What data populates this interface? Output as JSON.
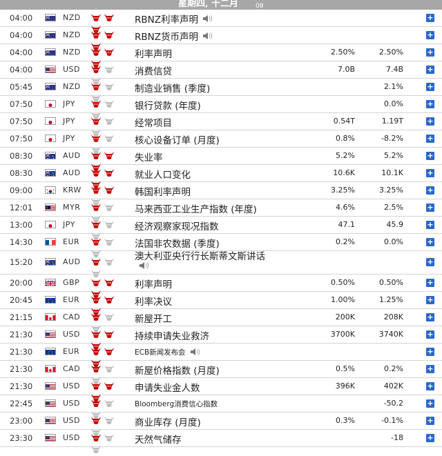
{
  "header": {
    "day": "星期四, 十二月",
    "date": "08"
  },
  "colors": {
    "bull_active": "#c40000",
    "bull_inactive": "#bdbdbd",
    "plus": "#2b67c6"
  },
  "rows": [
    {
      "time": "04:00",
      "flag": "nz",
      "currency": "NZD",
      "importance": 3,
      "event": "RBNZ利率声明",
      "speaker": true,
      "actual": "",
      "previous": ""
    },
    {
      "time": "04:00",
      "flag": "nz",
      "currency": "NZD",
      "importance": 3,
      "event": "RBNZ货币声明",
      "speaker": true,
      "actual": "",
      "previous": ""
    },
    {
      "time": "04:00",
      "flag": "nz",
      "currency": "NZD",
      "importance": 3,
      "event": "利率声明",
      "speaker": false,
      "actual": "2.50%",
      "previous": "2.50%"
    },
    {
      "time": "04:00",
      "flag": "us",
      "currency": "USD",
      "importance": 1,
      "event": "消费信贷",
      "speaker": false,
      "actual": "7.0B",
      "previous": "7.4B"
    },
    {
      "time": "05:45",
      "flag": "nz",
      "currency": "NZD",
      "importance": 1,
      "event": "制造业销售 (季度)",
      "speaker": false,
      "actual": "",
      "previous": "2.1%"
    },
    {
      "time": "07:50",
      "flag": "jp",
      "currency": "JPY",
      "importance": 1,
      "event": "银行贷款 (年度)",
      "speaker": false,
      "actual": "",
      "previous": "0.0%"
    },
    {
      "time": "07:50",
      "flag": "jp",
      "currency": "JPY",
      "importance": 1,
      "event": "经常项目",
      "speaker": false,
      "actual": "0.54T",
      "previous": "1.19T"
    },
    {
      "time": "07:50",
      "flag": "jp",
      "currency": "JPY",
      "importance": 1,
      "event": "核心设备订单 (月度)",
      "speaker": false,
      "actual": "0.8%",
      "previous": "-8.2%"
    },
    {
      "time": "08:30",
      "flag": "au",
      "currency": "AUD",
      "importance": 3,
      "event": "失业率",
      "speaker": false,
      "actual": "5.2%",
      "previous": "5.2%"
    },
    {
      "time": "08:30",
      "flag": "au",
      "currency": "AUD",
      "importance": 3,
      "event": "就业人口变化",
      "speaker": false,
      "actual": "10.6K",
      "previous": "10.1K"
    },
    {
      "time": "09:00",
      "flag": "kr",
      "currency": "KRW",
      "importance": 2,
      "event": "韩国利率声明",
      "speaker": false,
      "actual": "3.25%",
      "previous": "3.25%"
    },
    {
      "time": "12:01",
      "flag": "my",
      "currency": "MYR",
      "importance": 1,
      "event": "马来西亚工业生产指数 (年度)",
      "speaker": false,
      "actual": "4.6%",
      "previous": "2.5%"
    },
    {
      "time": "13:00",
      "flag": "jp",
      "currency": "JPY",
      "importance": 1,
      "event": "经济观察家现况指数",
      "speaker": false,
      "actual": "47.1",
      "previous": "45.9"
    },
    {
      "time": "14:30",
      "flag": "fr",
      "currency": "EUR",
      "importance": 1,
      "event": "法国非农数据 (季度)",
      "speaker": false,
      "actual": "0.2%",
      "previous": "0.0%"
    },
    {
      "time": "15:20",
      "flag": "au",
      "currency": "AUD",
      "importance": 1,
      "event": "澳大利亚央行行长斯蒂文斯讲话",
      "speaker": true,
      "actual": "",
      "previous": "",
      "tall": true
    },
    {
      "time": "20:00",
      "flag": "gb",
      "currency": "GBP",
      "importance": 3,
      "event": "利率声明",
      "speaker": false,
      "actual": "0.50%",
      "previous": "0.50%"
    },
    {
      "time": "20:45",
      "flag": "eu",
      "currency": "EUR",
      "importance": 3,
      "event": "利率决议",
      "speaker": false,
      "actual": "1.00%",
      "previous": "1.25%"
    },
    {
      "time": "21:15",
      "flag": "ca",
      "currency": "CAD",
      "importance": 1,
      "event": "新屋开工",
      "speaker": false,
      "actual": "200K",
      "previous": "208K"
    },
    {
      "time": "21:30",
      "flag": "us",
      "currency": "USD",
      "importance": 3,
      "event": "持续申请失业救济",
      "speaker": false,
      "actual": "3700K",
      "previous": "3740K"
    },
    {
      "time": "21:30",
      "flag": "eu",
      "currency": "EUR",
      "importance": 3,
      "event": "ECB新闻发布会",
      "speaker": true,
      "actual": "",
      "previous": "",
      "small": true
    },
    {
      "time": "21:30",
      "flag": "ca",
      "currency": "CAD",
      "importance": 1,
      "event": "新屋价格指数 (月度)",
      "speaker": false,
      "actual": "0.5%",
      "previous": "0.2%"
    },
    {
      "time": "21:30",
      "flag": "us",
      "currency": "USD",
      "importance": 3,
      "event": "申请失业金人数",
      "speaker": false,
      "actual": "396K",
      "previous": "402K"
    },
    {
      "time": "22:45",
      "flag": "us",
      "currency": "USD",
      "importance": 1,
      "event": "Bloomberg消费信心指数",
      "speaker": false,
      "actual": "",
      "previous": "-50.2",
      "small": true
    },
    {
      "time": "23:00",
      "flag": "us",
      "currency": "USD",
      "importance": 1,
      "event": "商业库存 (月度)",
      "speaker": false,
      "actual": "0.3%",
      "previous": "-0.1%"
    },
    {
      "time": "23:30",
      "flag": "us",
      "currency": "USD",
      "importance": 1,
      "event": "天然气储存",
      "speaker": false,
      "actual": "",
      "previous": "-18"
    }
  ]
}
